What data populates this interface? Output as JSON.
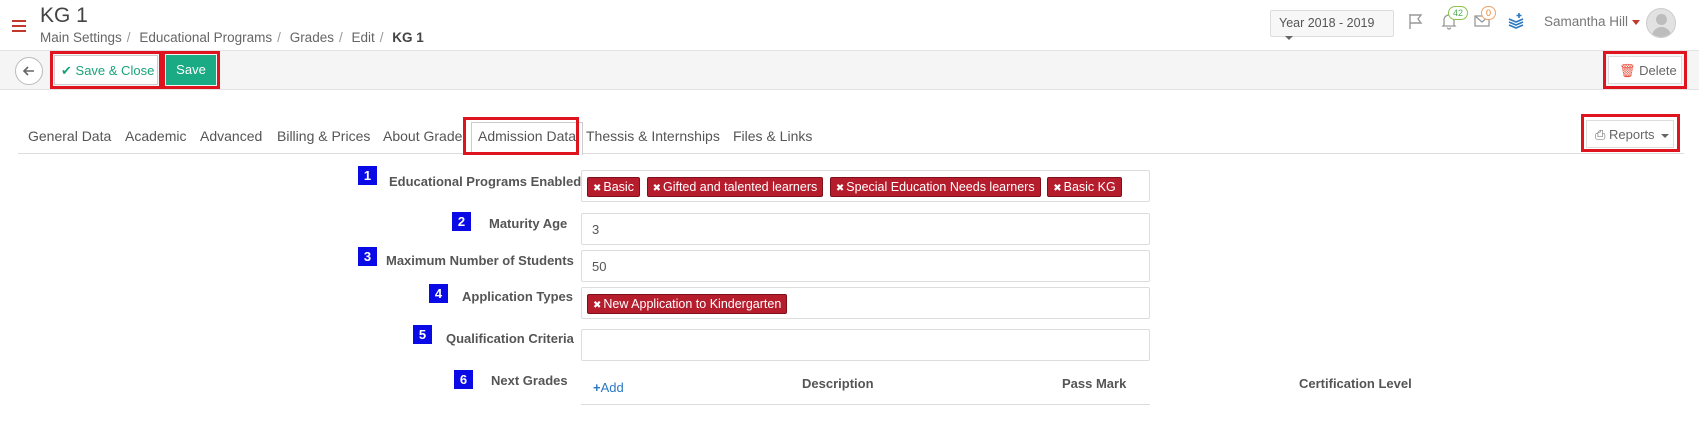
{
  "header": {
    "title": "KG 1",
    "breadcrumb": [
      "Main Settings",
      "Educational Programs",
      "Grades",
      "Edit",
      "KG 1"
    ],
    "year": "Year 2018 - 2019",
    "notifications_count": "42",
    "messages_count": "0",
    "user_name": "Samantha Hill"
  },
  "toolbar": {
    "save_close_label": "Save & Close",
    "save_label": "Save",
    "delete_label": "Delete"
  },
  "tabs": [
    {
      "label": "General Data"
    },
    {
      "label": "Academic"
    },
    {
      "label": "Advanced"
    },
    {
      "label": "Billing & Prices"
    },
    {
      "label": "About Grade"
    },
    {
      "label": "Admission Data",
      "active": true
    },
    {
      "label": "Thessis & Internships"
    },
    {
      "label": "Files & Links"
    }
  ],
  "reports_label": "Reports",
  "form": {
    "educational_programs": {
      "number": "1",
      "label": "Educational Programs Enabled",
      "tags": [
        "Basic",
        "Gifted and talented learners",
        "Special Education Needs learners",
        "Basic KG"
      ]
    },
    "maturity_age": {
      "number": "2",
      "label": "Maturity Age",
      "value": "3"
    },
    "max_students": {
      "number": "3",
      "label": "Maximum Number of Students",
      "value": "50"
    },
    "application_types": {
      "number": "4",
      "label": "Application Types",
      "tags": [
        "New Application to Kindergarten"
      ]
    },
    "qualification_criteria": {
      "number": "5",
      "label": "Qualification Criteria",
      "value": ""
    },
    "next_grades": {
      "number": "6",
      "label": "Next Grades",
      "add_label": "Add",
      "columns": [
        "Description",
        "Pass Mark",
        "Certification Level"
      ]
    }
  },
  "colors": {
    "highlight": "#e0141e",
    "badge": "#0a0ae6",
    "tag": "#b51d2d",
    "save": "#1aaa84"
  }
}
